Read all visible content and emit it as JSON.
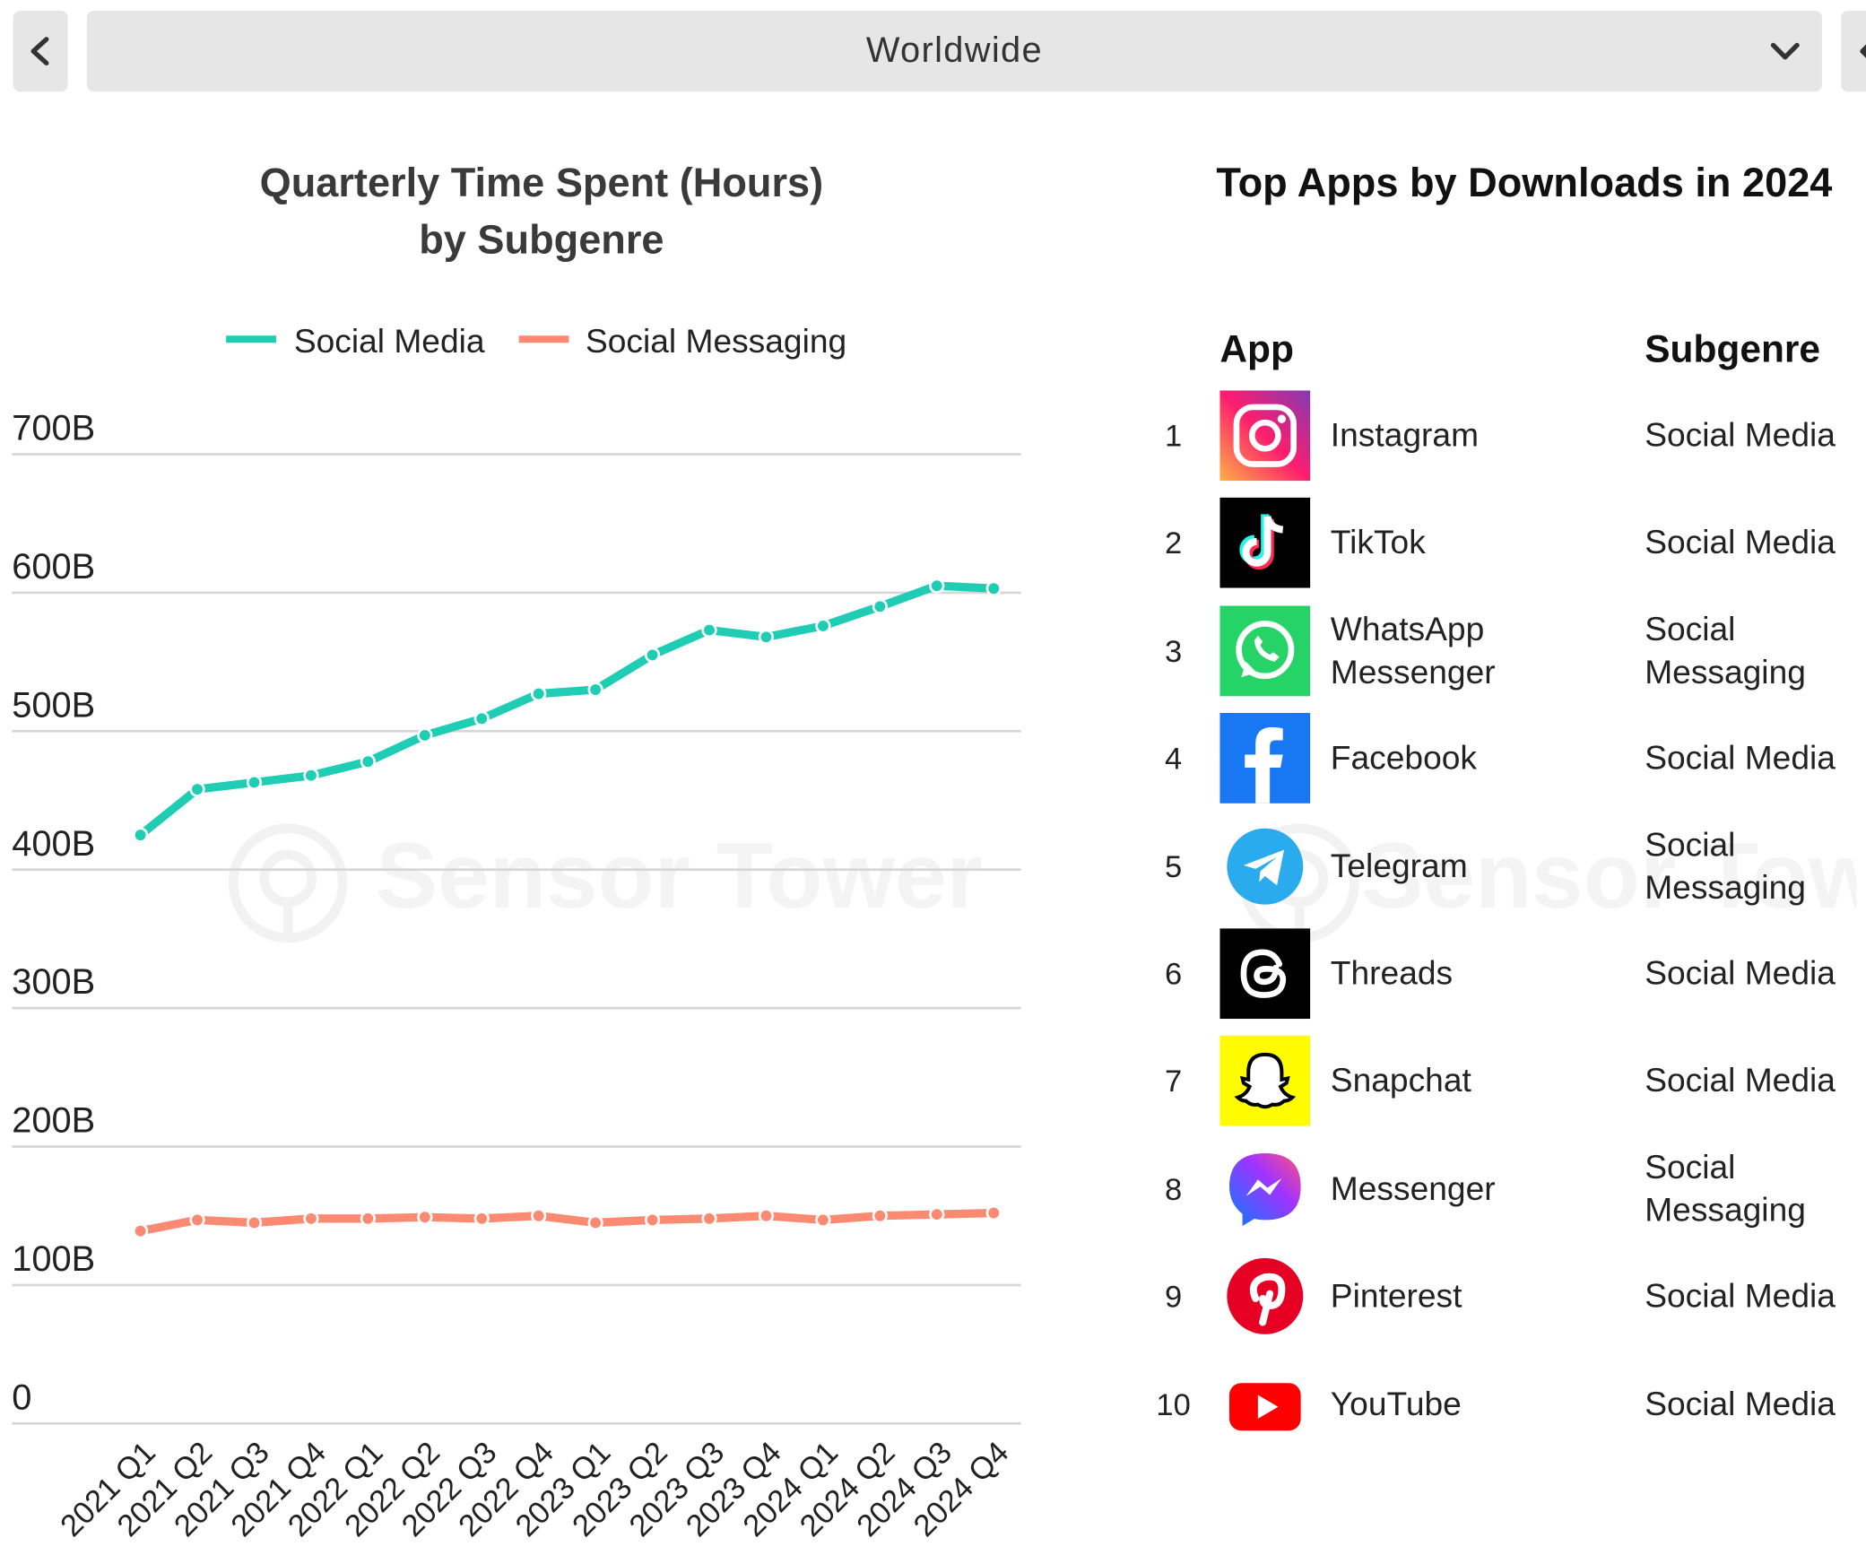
{
  "region_select": {
    "value": "Worldwide"
  },
  "icons": {
    "prev": "chevron-left-icon",
    "next": "close-icon",
    "dropdown": "chevron-down-icon"
  },
  "watermark": "Sensor Tower",
  "chart_title": {
    "line1": "Quarterly Time Spent (Hours)",
    "line2": "by Subgenre"
  },
  "chart_data": {
    "type": "line",
    "categories": [
      "2021 Q1",
      "2021 Q2",
      "2021 Q3",
      "2021 Q4",
      "2022 Q1",
      "2022 Q2",
      "2022 Q3",
      "2022 Q4",
      "2023 Q1",
      "2023 Q2",
      "2023 Q3",
      "2023 Q4",
      "2024 Q1",
      "2024 Q2",
      "2024 Q3",
      "2024 Q4"
    ],
    "series": [
      {
        "name": "Social Media",
        "color": "#1fcdb4",
        "values": [
          425,
          458,
          463,
          468,
          478,
          497,
          509,
          527,
          530,
          555,
          573,
          568,
          576,
          590,
          605,
          603
        ]
      },
      {
        "name": "Social Messaging",
        "color": "#fb8a72",
        "values": [
          139,
          147,
          145,
          148,
          148,
          149,
          148,
          150,
          145,
          147,
          148,
          150,
          147,
          150,
          151,
          152
        ]
      }
    ],
    "y_ticks": [
      "0",
      "100B",
      "200B",
      "300B",
      "400B",
      "500B",
      "600B",
      "700B"
    ],
    "ylim": [
      0,
      700
    ],
    "grid": true,
    "legend": "top"
  },
  "table": {
    "title": "Top Apps by Downloads in 2024",
    "col_app": "App",
    "col_subgenre": "Subgenre",
    "rows": [
      {
        "rank": "1",
        "name": "Instagram",
        "subgenre": "Social Media",
        "icon": "instagram-icon"
      },
      {
        "rank": "2",
        "name": "TikTok",
        "subgenre": "Social Media",
        "icon": "tiktok-icon"
      },
      {
        "rank": "3",
        "name": "WhatsApp Messenger",
        "subgenre": "Social Messaging",
        "icon": "whatsapp-icon"
      },
      {
        "rank": "4",
        "name": "Facebook",
        "subgenre": "Social Media",
        "icon": "facebook-icon"
      },
      {
        "rank": "5",
        "name": "Telegram",
        "subgenre": "Social Messaging",
        "icon": "telegram-icon"
      },
      {
        "rank": "6",
        "name": "Threads",
        "subgenre": "Social Media",
        "icon": "threads-icon"
      },
      {
        "rank": "7",
        "name": "Snapchat",
        "subgenre": "Social Media",
        "icon": "snapchat-icon"
      },
      {
        "rank": "8",
        "name": "Messenger",
        "subgenre": "Social Messaging",
        "icon": "messenger-icon"
      },
      {
        "rank": "9",
        "name": "Pinterest",
        "subgenre": "Social Media",
        "icon": "pinterest-icon"
      },
      {
        "rank": "10",
        "name": "YouTube",
        "subgenre": "Social Media",
        "icon": "youtube-icon"
      }
    ]
  }
}
